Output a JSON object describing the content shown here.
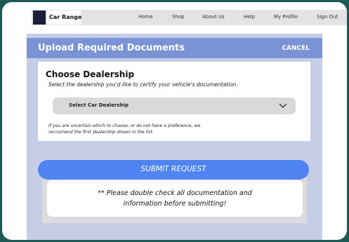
{
  "nav": {
    "brand": "Car Range",
    "links": [
      "Home",
      "Shop",
      "About Us",
      "Help",
      "My Profile",
      "Sign Out"
    ]
  },
  "header": {
    "title": "Upload Required Documents",
    "cancel_label": "CANCEL"
  },
  "dealership": {
    "title": "Choose Dealership",
    "subtitle": "Select the dealership you'd like to certify your vehicle's documentation.",
    "select_value": "Select Car Dealership",
    "hint_lines": [
      "If you are uncertain which to choose, or do not have a preference, we",
      "reccomend the first dealership shown in the list."
    ]
  },
  "submit": {
    "label": "SUBMIT REQUEST",
    "note_lines": [
      "** Please double check all documentation and",
      "information before submitting!"
    ]
  },
  "colors": {
    "header": "#7a93d5",
    "panel": "#c6cde6",
    "submit": "#4f84f2",
    "logo": "#1b1d3b",
    "frame_border": "#1e5a55"
  },
  "icons": {
    "select_indicator": "chevron-down-icon"
  }
}
